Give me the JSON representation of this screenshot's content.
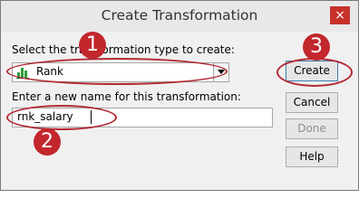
{
  "window": {
    "title": "Create Transformation",
    "close_glyph": "×"
  },
  "form": {
    "type_label": "Select the transformation type to create:",
    "type_value": "Rank",
    "type_icon": "bar-chart-icon",
    "name_label": "Enter a new name for this transformation:",
    "name_value": "rnk_salary"
  },
  "buttons": {
    "create": "Create",
    "cancel": "Cancel",
    "done": "Done",
    "help": "Help"
  },
  "annotations": {
    "step1": "1",
    "step2": "2",
    "step3": "3",
    "color": "#c2272d"
  }
}
